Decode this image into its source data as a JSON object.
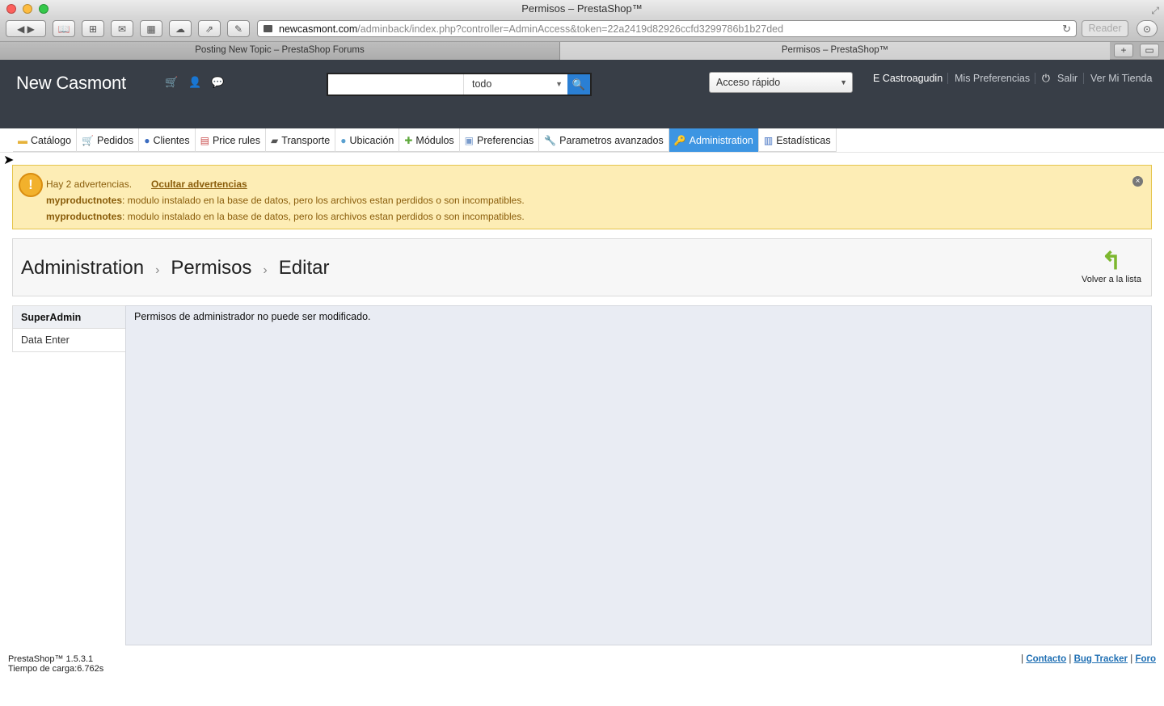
{
  "window": {
    "title": "Permisos – PrestaShop™"
  },
  "browser": {
    "address_host": "newcasmont.com",
    "address_path": "/adminback/index.php?controller=AdminAccess&token=22a2419d82926ccfd3299786b1b27ded",
    "reader_label": "Reader",
    "tabs": [
      {
        "label": "Posting New Topic – PrestaShop Forums"
      },
      {
        "label": "Permisos – PrestaShop™"
      }
    ]
  },
  "header": {
    "brand": "New Casmont",
    "search_value": "",
    "search_scope": "todo",
    "quick_access": "Acceso rápido",
    "user": "E Castroagudin",
    "preferences": "Mis Preferencias",
    "logout": "Salir",
    "view_store": "Ver Mi Tienda"
  },
  "nav": {
    "items": [
      {
        "label": "Catálogo",
        "icon": "folder-icon"
      },
      {
        "label": "Pedidos",
        "icon": "cart-icon"
      },
      {
        "label": "Clientes",
        "icon": "user-icon"
      },
      {
        "label": "Price rules",
        "icon": "price-tag-icon"
      },
      {
        "label": "Transporte",
        "icon": "truck-icon"
      },
      {
        "label": "Ubicación",
        "icon": "globe-icon"
      },
      {
        "label": "Módulos",
        "icon": "puzzle-icon"
      },
      {
        "label": "Preferencias",
        "icon": "preferences-icon"
      },
      {
        "label": "Parametros avanzados",
        "icon": "wrench-icon"
      },
      {
        "label": "Administration",
        "icon": "key-icon",
        "active": true
      },
      {
        "label": "Estadísticas",
        "icon": "bar-chart-icon"
      }
    ]
  },
  "warnings": {
    "summary": "Hay 2 advertencias.",
    "hide_link": "Ocultar advertencias",
    "items": [
      {
        "module": "myproductnotes",
        "text": ": modulo instalado en la base de datos, pero los archivos estan perdidos o son incompatibles."
      },
      {
        "module": "myproductnotes",
        "text": ": modulo instalado en la base de datos, pero los archivos estan perdidos o son incompatibles."
      }
    ]
  },
  "breadcrumb": {
    "level1": "Administration",
    "level2": "Permisos",
    "level3": "Editar"
  },
  "back_button": "Volver a la lista",
  "profiles": [
    {
      "label": "SuperAdmin",
      "active": true
    },
    {
      "label": "Data Enter"
    }
  ],
  "content_message": "Permisos de administrador no puede ser modificado.",
  "footer": {
    "version": "PrestaShop™ 1.5.3.1",
    "load_time": "Tiempo de carga:6.762s",
    "contact": "Contacto",
    "bug_tracker": "Bug Tracker",
    "forum": "Foro"
  },
  "colors": {
    "header_bg": "#383e47",
    "nav_active": "#3d95e2",
    "warning_bg": "#fdedb5"
  }
}
